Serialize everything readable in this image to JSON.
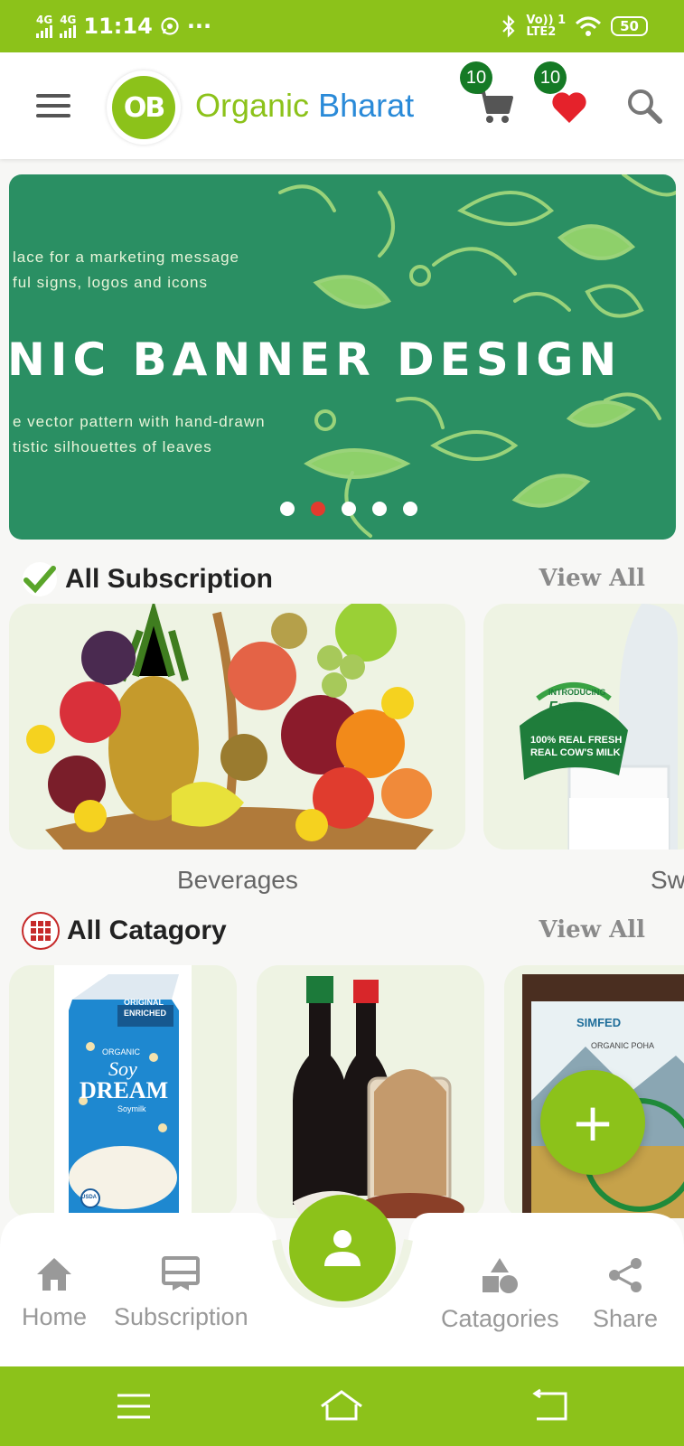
{
  "status_bar": {
    "net1": "4G",
    "net2": "4G",
    "time": "11:14",
    "more": "···",
    "volte": "Vo)) 1",
    "lte": "LTE2",
    "battery": "50"
  },
  "header": {
    "logo_text": "OB",
    "brand_first": "Organic",
    "brand_second": "Bharat",
    "cart_count": "10",
    "wishlist_count": "10"
  },
  "banner": {
    "line1": "lace for a marketing message",
    "line2": "ful signs, logos and icons",
    "heading": "NIC BANNER DESIGN",
    "line3": "e vector pattern with hand-drawn",
    "line4": "tistic silhouettes of leaves",
    "slides": 5,
    "active_slide": 2
  },
  "subscription": {
    "title": "All Subscription",
    "view_all": "View All",
    "cards": [
      {
        "caption": "Beverages"
      },
      {
        "caption": "Sw",
        "brand": "Frezu",
        "tagline1": "100% REAL FRESH",
        "tagline2": "REAL COW'S MILK",
        "intro": "INTRODUCING"
      }
    ]
  },
  "category": {
    "title": "All Catagory",
    "view_all": "View All",
    "soy": {
      "line1": "ORIGINAL",
      "line2": "ENRICHED",
      "line3": "ORGANIC",
      "brand1": "Soy",
      "brand2": "DREAM",
      "sub": "Soymilk",
      "usda": "USDA"
    },
    "simfed": {
      "brand": "SIMFED",
      "line": "ORGANIC POHA"
    }
  },
  "fab_label": "+",
  "bottom_nav": {
    "home": "Home",
    "subscription": "Subscription",
    "categories": "Catagories",
    "share": "Share"
  },
  "colors": {
    "primary": "#8cc21a",
    "brand_blue": "#2a8ad8",
    "banner_green": "#2a8f63",
    "badge_green": "#157a25",
    "heart_red": "#e5222b"
  }
}
